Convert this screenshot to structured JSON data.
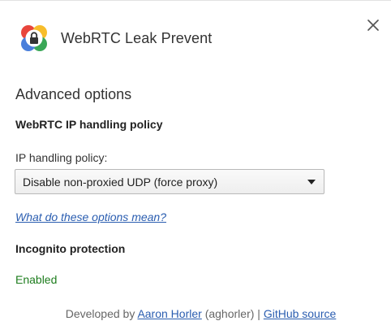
{
  "header": {
    "app_title": "WebRTC Leak Prevent",
    "logo_icon": "webrtc-lock-logo-icon",
    "close_icon": "close-icon"
  },
  "main": {
    "section_title": "Advanced options",
    "policy_heading": "WebRTC IP handling policy",
    "policy_label": "IP handling policy:",
    "policy_selected": "Disable non-proxied UDP (force proxy)",
    "help_link": "What do these options mean?",
    "incognito_heading": "Incognito protection",
    "incognito_status": "Enabled"
  },
  "footer": {
    "prefix": "Developed by ",
    "author_link": "Aaron Horler",
    "author_handle": " (aghorler) | ",
    "source_link": "GitHub source"
  },
  "colors": {
    "link": "#2a5db0",
    "status_enabled": "#1e7d1e",
    "logo_red": "#e8453c",
    "logo_yellow": "#f7bd2b",
    "logo_green": "#3aa757",
    "logo_blue": "#4a7fdb"
  }
}
